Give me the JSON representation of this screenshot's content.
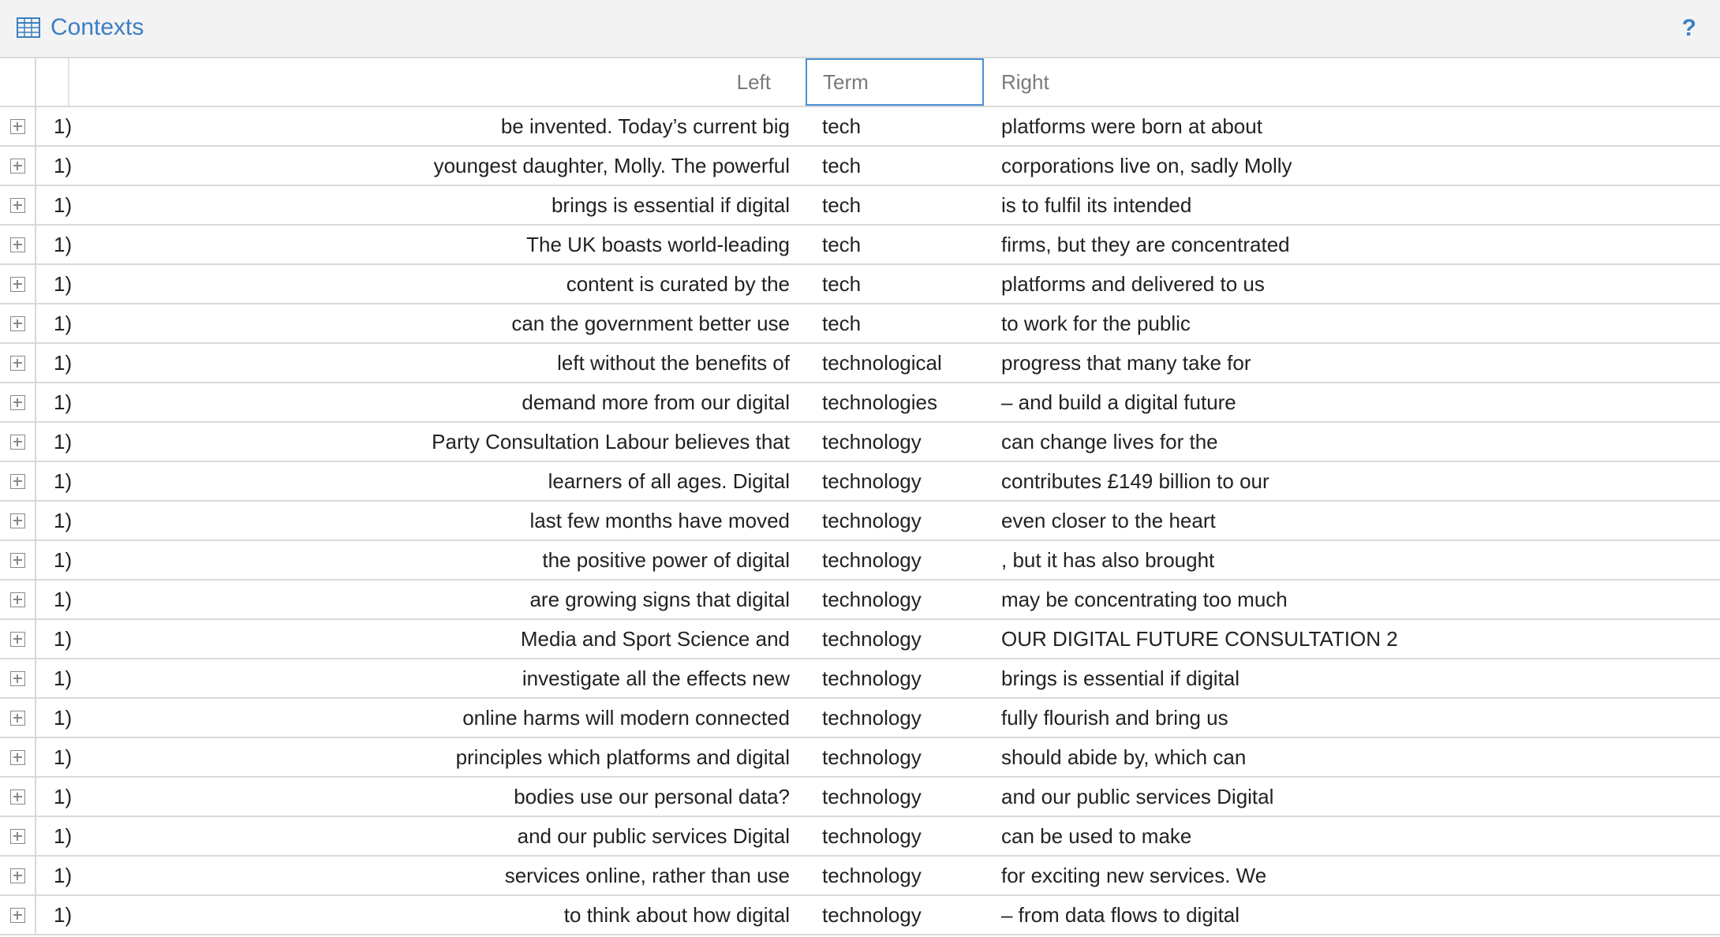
{
  "header": {
    "title": "Contexts",
    "help_label": "?",
    "accent_color": "#3a7fc4",
    "icon": "table-grid-icon"
  },
  "columns": {
    "left": "Left",
    "term": "Term",
    "right": "Right"
  },
  "rows": [
    {
      "num": "1)",
      "left": "be invented. Today’s current big",
      "term": "tech",
      "right": "platforms were born at about"
    },
    {
      "num": "1)",
      "left": "youngest daughter, Molly. The powerful",
      "term": "tech",
      "right": "corporations live on, sadly Molly"
    },
    {
      "num": "1)",
      "left": "brings is essential if digital",
      "term": "tech",
      "right": "is to fulfil its intended"
    },
    {
      "num": "1)",
      "left": "The UK boasts world-leading",
      "term": "tech",
      "right": "firms, but they are concentrated"
    },
    {
      "num": "1)",
      "left": "content is curated by the",
      "term": "tech",
      "right": "platforms and delivered to us"
    },
    {
      "num": "1)",
      "left": "can the government better use",
      "term": "tech",
      "right": "to work for the public"
    },
    {
      "num": "1)",
      "left": "left without the benefits of",
      "term": "technological",
      "right": "progress that many take for"
    },
    {
      "num": "1)",
      "left": "demand more from our digital",
      "term": "technologies",
      "right": "– and build a digital future"
    },
    {
      "num": "1)",
      "left": "Party Consultation Labour believes that",
      "term": "technology",
      "right": "can change lives for the"
    },
    {
      "num": "1)",
      "left": "learners of all ages. Digital",
      "term": "technology",
      "right": "contributes £149 billion to our"
    },
    {
      "num": "1)",
      "left": "last few months have moved",
      "term": "technology",
      "right": "even closer to the heart"
    },
    {
      "num": "1)",
      "left": "the positive power of digital",
      "term": "technology",
      "right": ", but it has also brought"
    },
    {
      "num": "1)",
      "left": "are growing signs that digital",
      "term": "technology",
      "right": "may be concentrating too much"
    },
    {
      "num": "1)",
      "left": "Media and Sport Science and",
      "term": "technology",
      "right": "OUR DIGITAL FUTURE CONSULTATION 2"
    },
    {
      "num": "1)",
      "left": "investigate all the effects new",
      "term": "technology",
      "right": "brings is essential if digital"
    },
    {
      "num": "1)",
      "left": "online harms will modern connected",
      "term": "technology",
      "right": "fully flourish and bring us"
    },
    {
      "num": "1)",
      "left": "principles which platforms and digital",
      "term": "technology",
      "right": "should abide by, which can"
    },
    {
      "num": "1)",
      "left": "bodies use our personal data?",
      "term": "technology",
      "right": "and our public services Digital"
    },
    {
      "num": "1)",
      "left": "and our public services Digital",
      "term": "technology",
      "right": "can be used to make"
    },
    {
      "num": "1)",
      "left": "services online, rather than use",
      "term": "technology",
      "right": "for exciting new services. We"
    },
    {
      "num": "1)",
      "left": "to think about how digital",
      "term": "technology",
      "right": "– from data flows to digital"
    }
  ]
}
